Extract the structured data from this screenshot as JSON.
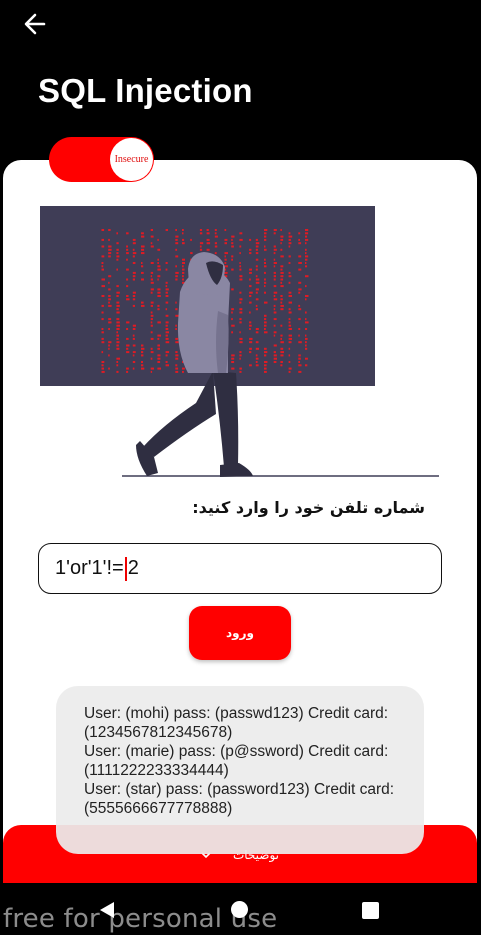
{
  "app": {
    "title": "SQL Injection"
  },
  "toggle": {
    "label": "Insecure",
    "state": "on",
    "color": "#ff0000"
  },
  "form": {
    "prompt": "شماره تلفن خود را وارد کنید:",
    "input_before_cursor": "1'or'1'!=",
    "input_after_cursor": "2",
    "login_label": "ورود"
  },
  "results": [
    "User: (mohi) pass: (passwd123) Credit card: (1234567812345678)",
    "User: (marie) pass: (p@ssword) Credit card: (1111222233334444)",
    "User: (star) pass: (password123) Credit card: (5555666677778888)"
  ],
  "details": {
    "label": "توضیحات",
    "icon": "chevron-down-icon"
  },
  "watermark": "free for personal use",
  "colors": {
    "accent": "#ff0000",
    "background": "#000000",
    "card": "#ffffff",
    "result_box": "#ececec"
  }
}
